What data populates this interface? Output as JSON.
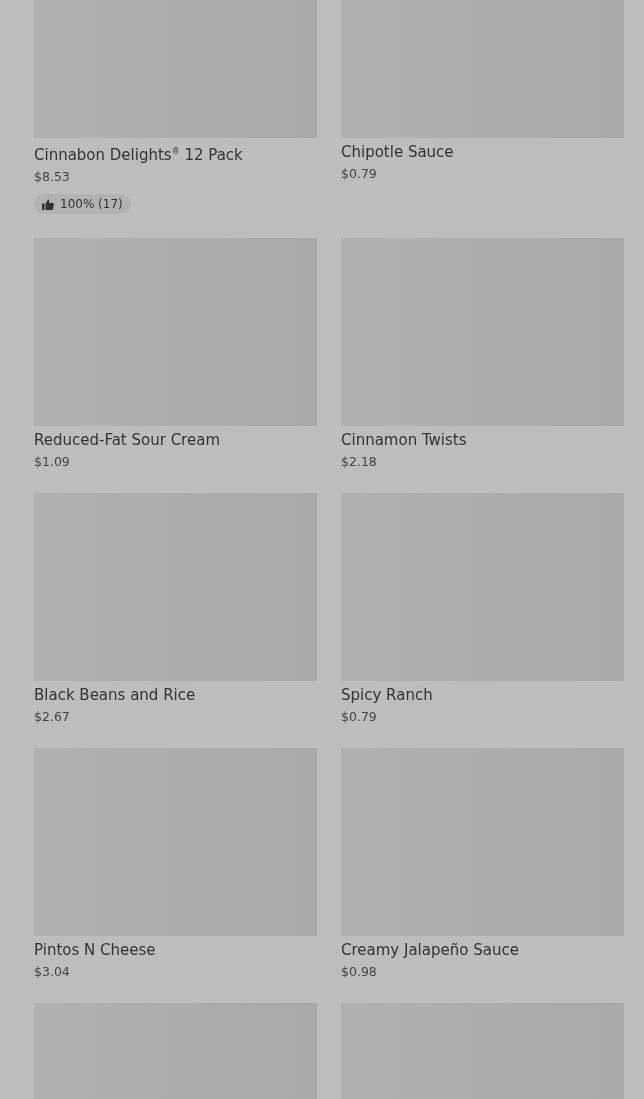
{
  "products": [
    {
      "kind": "product",
      "name": "Cinnabon Delights$^{®}$ 12 Pack",
      "price": "$8.53",
      "rating": "100% (17)"
    },
    {
      "kind": "product",
      "name": "Chipotle Sauce",
      "price": "$0.79"
    },
    {
      "kind": "product",
      "name": "Reduced-Fat Sour Cream",
      "price": "$1.09"
    },
    {
      "kind": "product",
      "name": "Cinnamon Twists",
      "price": "$2.18"
    },
    {
      "kind": "product",
      "name": "Black Beans and Rice",
      "price": "$2.67"
    },
    {
      "kind": "product",
      "name": "Spicy Ranch",
      "price": "$0.79"
    },
    {
      "kind": "product",
      "name": "Pintos N Cheese",
      "price": "$3.04"
    },
    {
      "kind": "product",
      "name": "Creamy Jalapeño Sauce",
      "price": "$0.98"
    },
    {
      "kind": "image_only"
    },
    {
      "kind": "image_only"
    }
  ]
}
